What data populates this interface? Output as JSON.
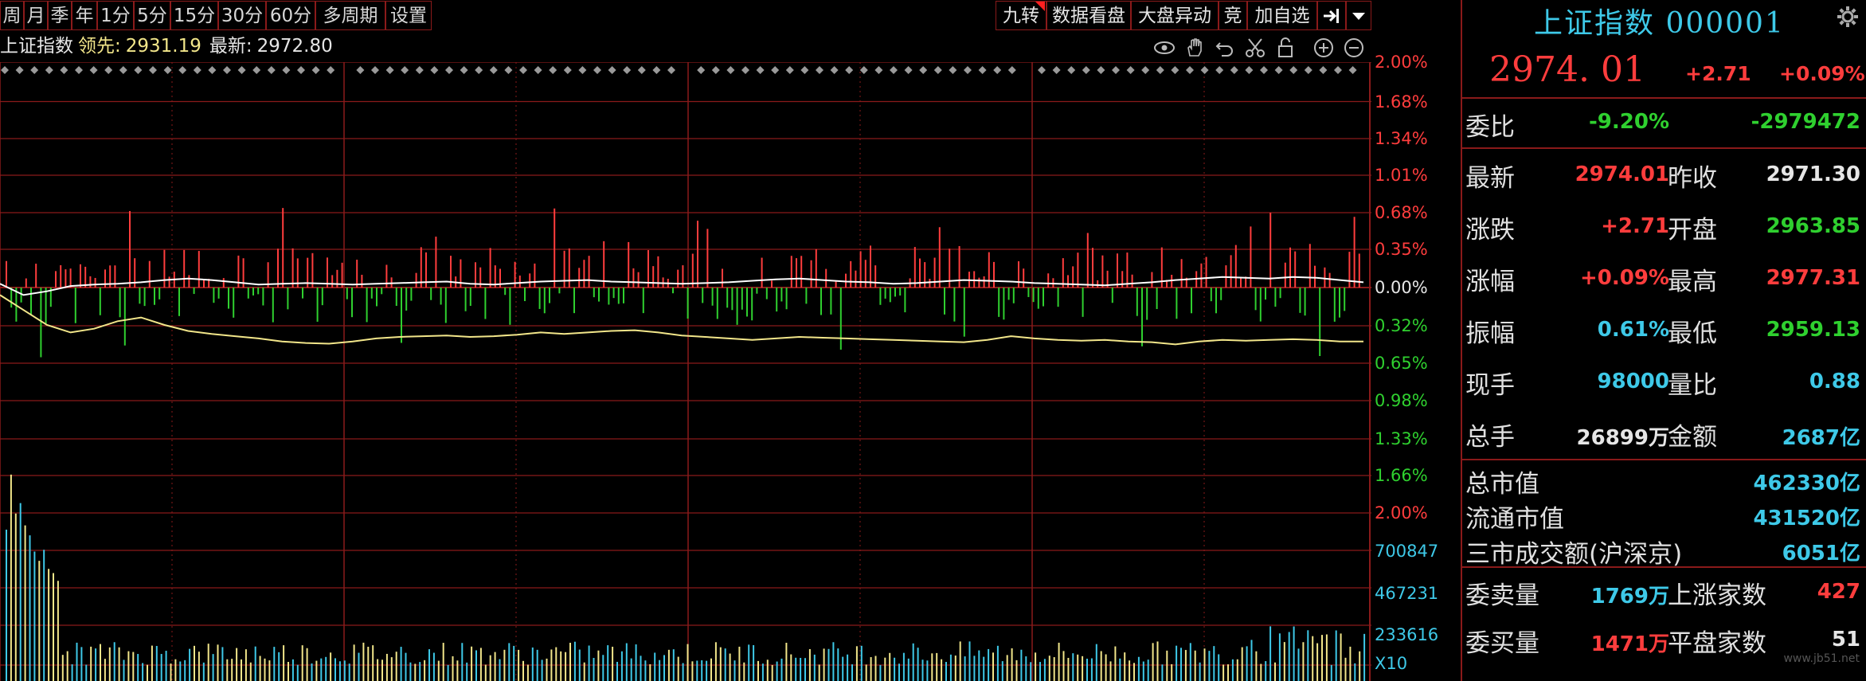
{
  "toolbar": {
    "left_items": [
      "周",
      "月",
      "季",
      "年",
      "1分",
      "5分",
      "15分",
      "30分",
      "60分",
      "多周期",
      "设置"
    ],
    "right_items": [
      "九转",
      "数据看盘",
      "大盘异动",
      "竞",
      "加自选"
    ]
  },
  "info": {
    "name": "上证指数",
    "lead_label": "领先:",
    "lead_value": "2931.19",
    "latest_label": "最新:",
    "latest_value": "2972.80"
  },
  "chart_data": {
    "type": "line",
    "price_axis_labels": [
      "2.00%",
      "1.68%",
      "1.34%",
      "1.01%",
      "0.68%",
      "0.35%",
      "0.00%",
      "0.32%",
      "0.65%",
      "0.98%",
      "1.33%",
      "1.66%",
      "2.00%"
    ],
    "volume_axis_labels": [
      "700847",
      "467231",
      "233616",
      "X10"
    ],
    "prev_close": 2971.3,
    "series": [
      {
        "values": [
          0.05,
          -0.1,
          -0.05,
          0.02,
          0.04,
          0.05,
          0.07,
          0.1,
          0.12,
          0.1,
          0.07,
          0.04,
          0.05,
          0.06,
          0.05,
          0.04,
          0.05,
          0.06,
          0.07,
          0.08,
          0.05,
          0.04,
          0.06,
          0.08,
          0.09,
          0.1,
          0.08,
          0.07,
          0.06,
          0.05,
          0.06,
          0.07,
          0.09,
          0.11,
          0.12,
          0.1,
          0.08,
          0.07,
          0.05,
          0.06,
          0.08,
          0.1,
          0.09,
          0.08,
          0.06,
          0.05,
          0.04,
          0.03,
          0.05,
          0.07,
          0.1,
          0.12,
          0.14,
          0.13,
          0.12,
          0.14,
          0.13,
          0.1,
          0.07
        ]
      },
      {
        "values": [
          -0.1,
          -0.3,
          -0.5,
          -0.6,
          -0.55,
          -0.45,
          -0.4,
          -0.5,
          -0.58,
          -0.62,
          -0.65,
          -0.68,
          -0.72,
          -0.74,
          -0.75,
          -0.72,
          -0.68,
          -0.66,
          -0.65,
          -0.64,
          -0.66,
          -0.65,
          -0.63,
          -0.6,
          -0.62,
          -0.6,
          -0.58,
          -0.57,
          -0.6,
          -0.64,
          -0.66,
          -0.68,
          -0.7,
          -0.68,
          -0.66,
          -0.67,
          -0.68,
          -0.69,
          -0.7,
          -0.71,
          -0.72,
          -0.73,
          -0.7,
          -0.65,
          -0.68,
          -0.7,
          -0.71,
          -0.7,
          -0.72,
          -0.73,
          -0.76,
          -0.72,
          -0.7,
          -0.71,
          -0.7,
          -0.69,
          -0.7,
          -0.72,
          -0.72
        ]
      }
    ]
  },
  "panel": {
    "title": "上证指数 000001",
    "price": "2974. 01",
    "change": "+2.71",
    "change_pct": "+0.09%",
    "weibi_label": "委比",
    "weibi_pct": "-9.20%",
    "weibi_diff": "-2979472",
    "rows": [
      {
        "l1": "最新",
        "v1": "2974.01",
        "c1": "red",
        "l2": "昨收",
        "v2": "2971.30",
        "c2": "white"
      },
      {
        "l1": "涨跌",
        "v1": "+2.71",
        "c1": "red",
        "l2": "开盘",
        "v2": "2963.85",
        "c2": "green"
      },
      {
        "l1": "涨幅",
        "v1": "+0.09%",
        "c1": "red",
        "l2": "最高",
        "v2": "2977.31",
        "c2": "red"
      },
      {
        "l1": "振幅",
        "v1": "0.61%",
        "c1": "cyan",
        "l2": "最低",
        "v2": "2959.13",
        "c2": "green"
      },
      {
        "l1": "现手",
        "v1": "98000",
        "c1": "cyan",
        "l2": "量比",
        "v2": "0.88",
        "c2": "cyan"
      },
      {
        "l1": "总手",
        "v1": "26899万",
        "c1": "white",
        "l2": "金额",
        "v2": "2687亿",
        "c2": "cyan"
      }
    ],
    "mv_rows": [
      {
        "label": "总市值",
        "value": "462330亿"
      },
      {
        "label": "流通市值",
        "value": "431520亿"
      },
      {
        "label": "三市成交额(沪深京)",
        "value": "6051亿"
      }
    ],
    "bottom_rows": [
      {
        "l1": "委卖量",
        "v1": "1769万",
        "c1": "cyan",
        "l2": "上涨家数",
        "v2": "427",
        "c2": "red"
      },
      {
        "l1": "委买量",
        "v1": "1471万",
        "c1": "red",
        "l2": "平盘家数",
        "v2": "51",
        "c2": "white"
      }
    ],
    "watermark": "www.jb51.net"
  },
  "colors": {
    "grid": "#8a1a1a",
    "up": "#ff3d3d",
    "down": "#2fd02f",
    "index_line": "#ffffff",
    "lead_line": "#f2e68a",
    "cyan": "#3ec9e8"
  }
}
